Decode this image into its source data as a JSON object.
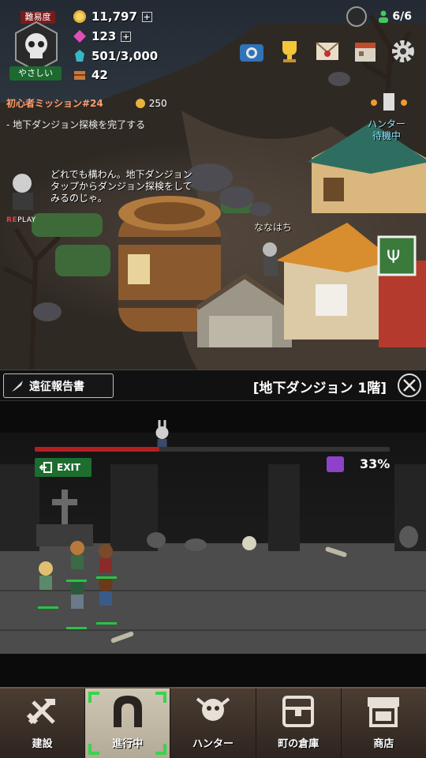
{
  "difficulty": {
    "label": "難易度",
    "value": "やさしい"
  },
  "resources": {
    "gold": "11,797",
    "gems": "123",
    "mana": "501/3,000",
    "materials": "42"
  },
  "population": "6/6",
  "mission": {
    "title": "初心者ミッション#24",
    "reward": "250",
    "description": "- 地下ダンジョン探検を完了する"
  },
  "npc": {
    "dialog": "どれでも構わん。地下ダンジョンタップからダンジョン探検をしてみるのじゃ。",
    "replay_prefix": "RE",
    "replay_rest": "PLAY"
  },
  "town_labels": {
    "character_name": "ななはち",
    "hunter_waiting_line1": "ハンター",
    "hunter_waiting_line2": "待機中"
  },
  "expedition": {
    "report_button": "遠征報告書",
    "dungeon_title": "[地下ダンジョン 1階]",
    "exit_label": "EXIT",
    "progress_percent": "33%",
    "progress_fraction": 0.35
  },
  "nav": [
    {
      "label": "建設",
      "icon": "build-icon"
    },
    {
      "label": "進行中",
      "icon": "gate-icon",
      "active": true
    },
    {
      "label": "ハンター",
      "icon": "hunter-icon"
    },
    {
      "label": "町の倉庫",
      "icon": "chest-icon"
    },
    {
      "label": "商店",
      "icon": "shop-icon"
    }
  ],
  "colors": {
    "progress": "#b42020",
    "exit": "#1d6d2f",
    "active_corner": "#39d34d",
    "mission_title": "#ff9d6c"
  }
}
